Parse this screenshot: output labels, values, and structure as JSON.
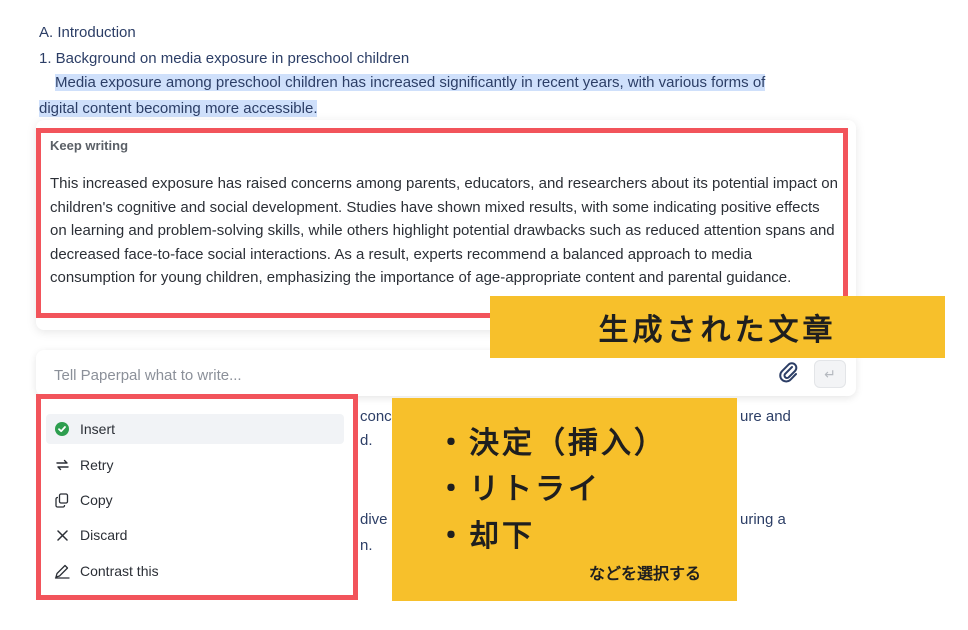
{
  "document": {
    "outline_a": "A. Introduction",
    "outline_1": "1. Background on media exposure in preschool children",
    "para_highlight_1": "Media exposure among preschool children has increased significantly in recent years, with various forms of",
    "para_highlight_2": "digital content becoming more accessible.",
    "obscured": {
      "line1_a": "conc",
      "line1_b": "ure and",
      "line2": "d.",
      "line3_a": "dive",
      "line3_b": "uring a",
      "line4": "n."
    }
  },
  "panel": {
    "label": "Keep writing",
    "generated_text": "This increased exposure has raised concerns among parents, educators, and researchers about its potential impact on children's cognitive and social development. Studies have shown mixed results, with some indicating positive effects on learning and problem-solving skills, while others highlight potential drawbacks such as reduced attention spans and decreased face-to-face social interactions. As a result, experts recommend a balanced approach to media consumption for young children, emphasizing the importance of age-appropriate content and parental guidance."
  },
  "input": {
    "placeholder": "Tell Paperpal what to write...",
    "value": ""
  },
  "menu": {
    "items": [
      {
        "label": "Insert",
        "icon": "check-circle-icon"
      },
      {
        "label": "Retry",
        "icon": "retry-icon"
      },
      {
        "label": "Copy",
        "icon": "copy-icon"
      },
      {
        "label": "Discard",
        "icon": "close-icon"
      },
      {
        "label": "Contrast this",
        "icon": "pencil-icon"
      }
    ]
  },
  "callouts": {
    "generated": "生成された文章",
    "bullets": [
      "・決定（挿入）",
      "・リトライ",
      "・却下"
    ],
    "note": "などを選択する"
  },
  "colors": {
    "highlight": "#cfe0fb",
    "frame_red": "#f2545b",
    "callout_yellow": "#f7c02b",
    "insert_green": "#2e9e4f"
  }
}
